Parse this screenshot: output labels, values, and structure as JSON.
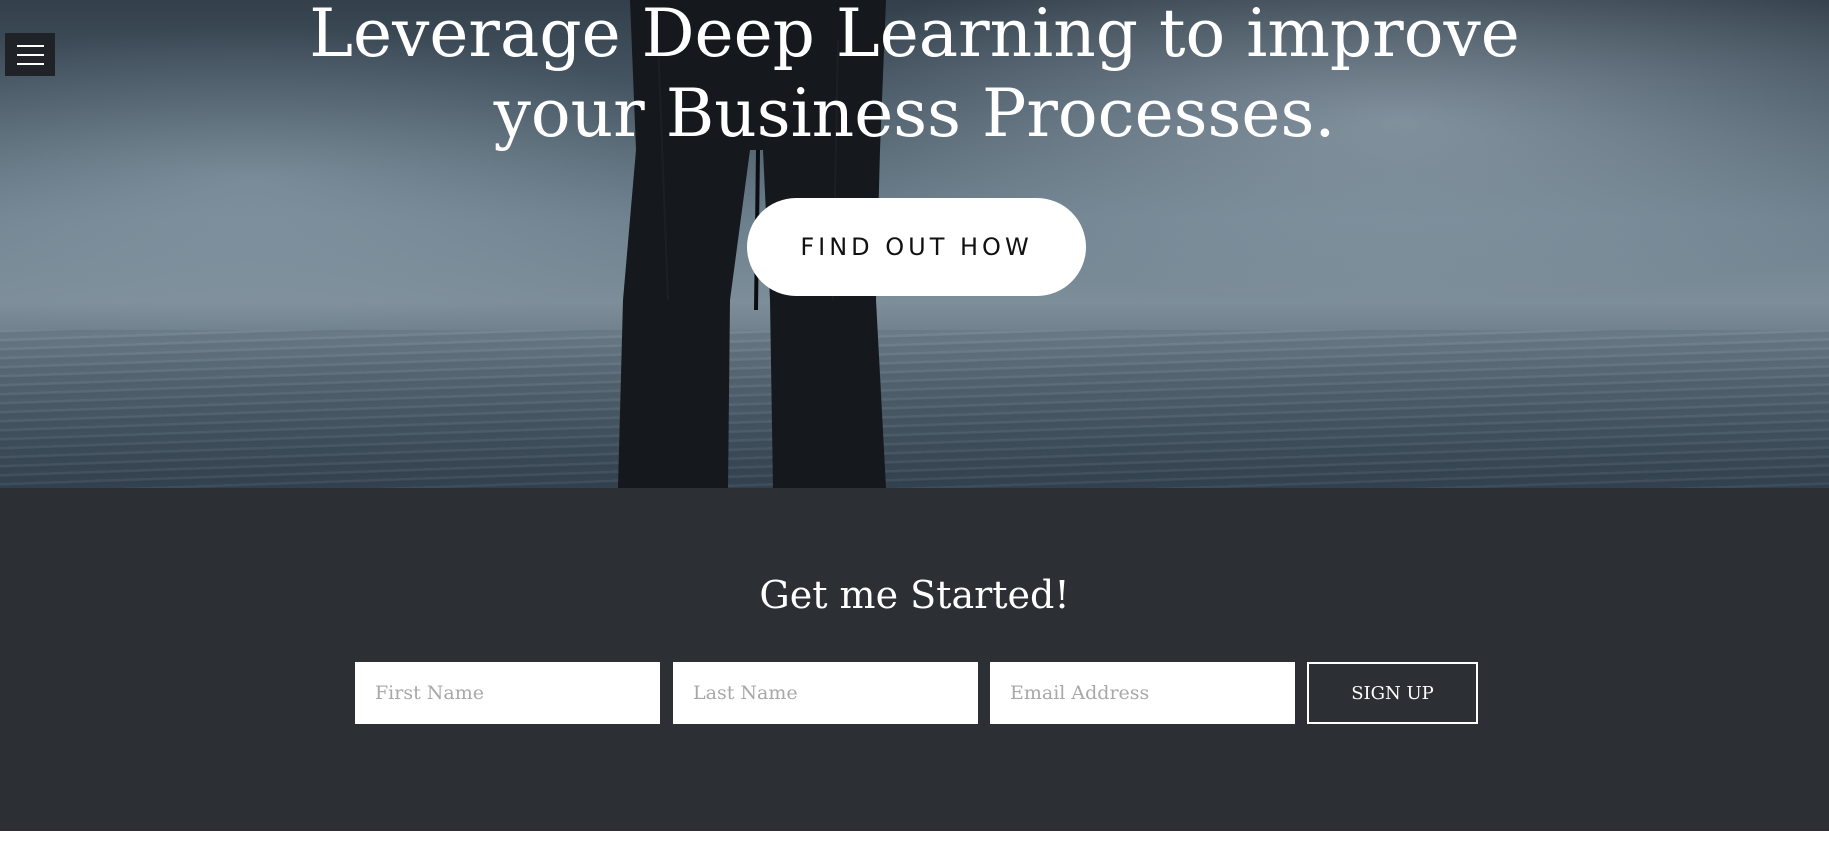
{
  "hero": {
    "title_line1": "Leverage Deep Learning to improve",
    "title_line2": "your Business Processes.",
    "cta_label": "FIND OUT HOW"
  },
  "signup": {
    "title": "Get me Started!",
    "first_name_placeholder": "First Name",
    "last_name_placeholder": "Last Name",
    "email_placeholder": "Email Address",
    "submit_label": "SIGN UP"
  },
  "colors": {
    "signup_background": "#2c2f34",
    "menu_background": "#1f2226",
    "cta_background": "#ffffff"
  },
  "icons": {
    "menu": "hamburger-menu-icon"
  }
}
